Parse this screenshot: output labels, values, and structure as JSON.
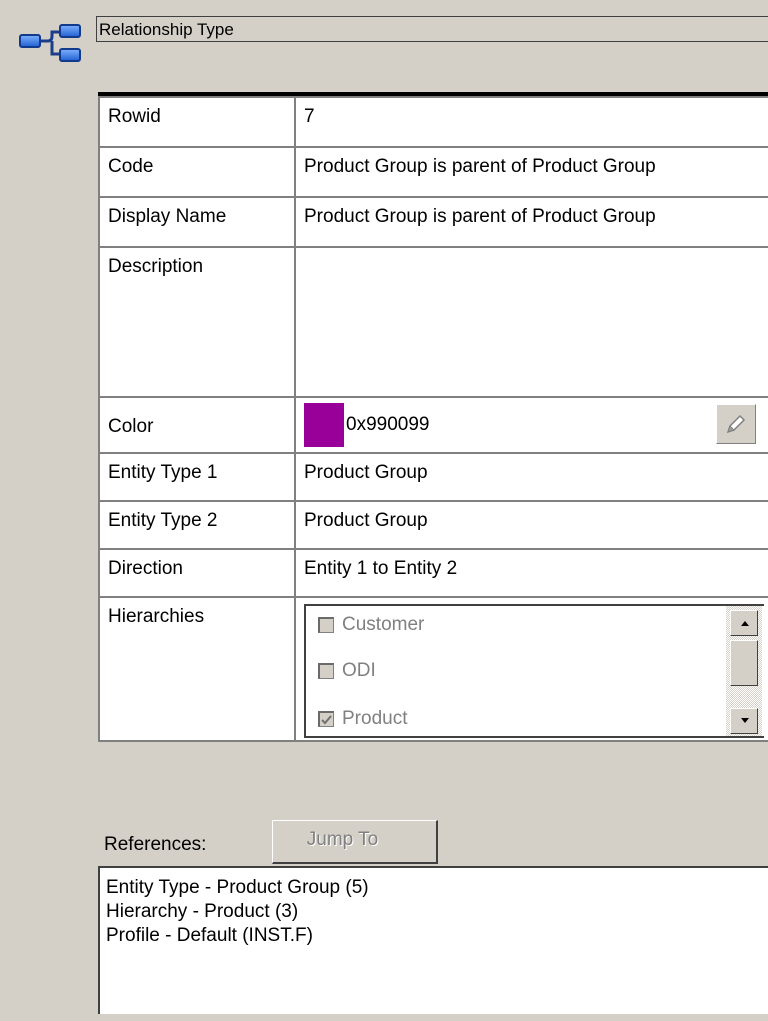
{
  "header": {
    "icon": "relationship-tree-icon",
    "title": "Relationship Type"
  },
  "fields": {
    "rowid": {
      "label": "Rowid",
      "value": "7"
    },
    "code": {
      "label": "Code",
      "value": "Product Group is parent of Product Group"
    },
    "display_name": {
      "label": "Display Name",
      "value": "Product Group is parent of Product Group"
    },
    "description": {
      "label": "Description",
      "value": ""
    },
    "color": {
      "label": "Color",
      "value": "0x990099",
      "swatch": "#990099",
      "edit_icon": "pencil-icon"
    },
    "entity_type_1": {
      "label": "Entity Type 1",
      "value": "Product Group"
    },
    "entity_type_2": {
      "label": "Entity Type 2",
      "value": "Product Group"
    },
    "direction": {
      "label": "Direction",
      "value": "Entity 1 to Entity 2"
    },
    "hierarchies": {
      "label": "Hierarchies",
      "items": [
        {
          "label": "Customer",
          "checked": false
        },
        {
          "label": "ODI",
          "checked": false
        },
        {
          "label": "Product",
          "checked": true
        }
      ]
    }
  },
  "references": {
    "label": "References:",
    "jump_button": "Jump To",
    "items": [
      "Entity Type - Product Group (5)",
      "Hierarchy - Product (3)",
      "Profile - Default (INST.F)"
    ]
  }
}
